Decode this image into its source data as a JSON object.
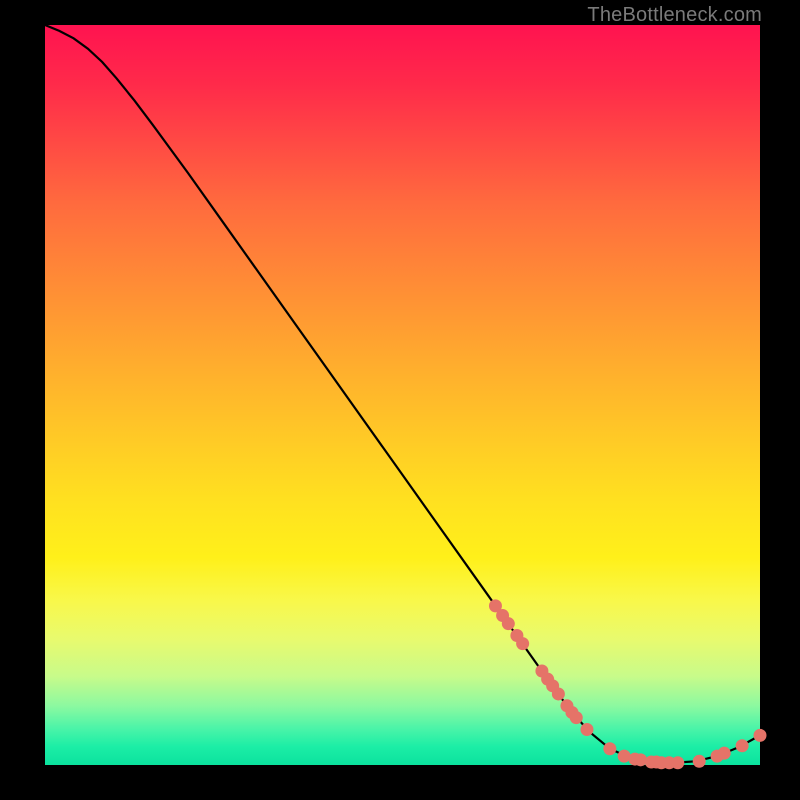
{
  "attribution": "TheBottleneck.com",
  "colors": {
    "curve": "#000000",
    "dot_fill": "#e57368",
    "dot_stroke": "#c45a50",
    "gradient_top": "#ff1350",
    "gradient_bottom": "#0be29e"
  },
  "chart_data": {
    "type": "line",
    "title": "",
    "xlabel": "",
    "ylabel": "",
    "xlim": [
      0,
      100
    ],
    "ylim": [
      0,
      100
    ],
    "curve": [
      {
        "x": 0.0,
        "y": 100.0
      },
      {
        "x": 2.0,
        "y": 99.2
      },
      {
        "x": 4.0,
        "y": 98.2
      },
      {
        "x": 6.0,
        "y": 96.8
      },
      {
        "x": 8.0,
        "y": 95.0
      },
      {
        "x": 10.0,
        "y": 92.8
      },
      {
        "x": 12.5,
        "y": 89.8
      },
      {
        "x": 15.0,
        "y": 86.6
      },
      {
        "x": 20.0,
        "y": 80.0
      },
      {
        "x": 25.0,
        "y": 73.2
      },
      {
        "x": 30.0,
        "y": 66.4
      },
      {
        "x": 35.0,
        "y": 59.6
      },
      {
        "x": 40.0,
        "y": 52.8
      },
      {
        "x": 45.0,
        "y": 46.0
      },
      {
        "x": 50.0,
        "y": 39.2
      },
      {
        "x": 55.0,
        "y": 32.4
      },
      {
        "x": 60.0,
        "y": 25.6
      },
      {
        "x": 65.0,
        "y": 18.8
      },
      {
        "x": 70.0,
        "y": 12.0
      },
      {
        "x": 73.0,
        "y": 8.0
      },
      {
        "x": 76.0,
        "y": 4.6
      },
      {
        "x": 79.0,
        "y": 2.2
      },
      {
        "x": 82.0,
        "y": 0.9
      },
      {
        "x": 85.0,
        "y": 0.4
      },
      {
        "x": 88.0,
        "y": 0.3
      },
      {
        "x": 91.0,
        "y": 0.5
      },
      {
        "x": 94.0,
        "y": 1.2
      },
      {
        "x": 97.0,
        "y": 2.4
      },
      {
        "x": 100.0,
        "y": 4.0
      }
    ],
    "series": [
      {
        "name": "markers",
        "points": [
          {
            "x": 63.0,
            "y": 21.5
          },
          {
            "x": 64.0,
            "y": 20.2
          },
          {
            "x": 64.8,
            "y": 19.1
          },
          {
            "x": 66.0,
            "y": 17.5
          },
          {
            "x": 66.8,
            "y": 16.4
          },
          {
            "x": 69.5,
            "y": 12.7
          },
          {
            "x": 70.3,
            "y": 11.6
          },
          {
            "x": 71.0,
            "y": 10.7
          },
          {
            "x": 71.8,
            "y": 9.6
          },
          {
            "x": 73.0,
            "y": 8.0
          },
          {
            "x": 73.7,
            "y": 7.1
          },
          {
            "x": 74.3,
            "y": 6.4
          },
          {
            "x": 75.8,
            "y": 4.8
          },
          {
            "x": 79.0,
            "y": 2.2
          },
          {
            "x": 81.0,
            "y": 1.2
          },
          {
            "x": 82.5,
            "y": 0.8
          },
          {
            "x": 83.3,
            "y": 0.7
          },
          {
            "x": 84.8,
            "y": 0.4
          },
          {
            "x": 85.5,
            "y": 0.4
          },
          {
            "x": 86.2,
            "y": 0.3
          },
          {
            "x": 87.3,
            "y": 0.3
          },
          {
            "x": 88.5,
            "y": 0.3
          },
          {
            "x": 91.5,
            "y": 0.5
          },
          {
            "x": 94.0,
            "y": 1.2
          },
          {
            "x": 95.0,
            "y": 1.6
          },
          {
            "x": 97.5,
            "y": 2.6
          },
          {
            "x": 100.0,
            "y": 4.0
          }
        ]
      }
    ]
  }
}
